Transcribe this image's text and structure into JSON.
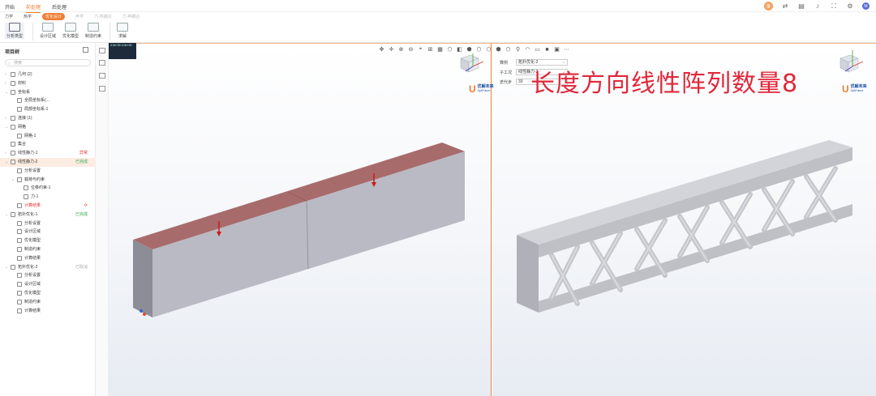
{
  "topbar": {
    "menus": [
      "开始",
      "前处理",
      "后处理"
    ],
    "active_menu": 1,
    "right_icons": [
      "share-icon",
      "document-icon",
      "bell-icon",
      "fullscreen-icon",
      "gear-icon"
    ],
    "badge": "备",
    "avatar": "M"
  },
  "ribbon_tabs": {
    "items": [
      "力学",
      "热学",
      "优化设计",
      "声学",
      "力-热耦合",
      "力-声耦合"
    ],
    "active": 2,
    "dim": [
      3,
      4,
      5
    ]
  },
  "ribbon": {
    "groups": [
      {
        "label": "分析类型"
      },
      {
        "label": "设计区域"
      },
      {
        "label": "优化模型"
      },
      {
        "label": "制造约束"
      },
      {
        "label": "求解"
      }
    ]
  },
  "sidebar": {
    "title": "项目树",
    "search_placeholder": "搜索",
    "tree": [
      {
        "label": "几何 (2)",
        "depth": 0,
        "arrow": "›"
      },
      {
        "label": "材料",
        "depth": 0,
        "arrow": "›"
      },
      {
        "label": "坐标系",
        "depth": 0,
        "arrow": "⌄"
      },
      {
        "label": "全局坐标系(...",
        "depth": 1,
        "arrow": ""
      },
      {
        "label": "局部坐标系-1",
        "depth": 1,
        "arrow": ""
      },
      {
        "label": "连接 (1)",
        "depth": 0,
        "arrow": "›"
      },
      {
        "label": "网格",
        "depth": 0,
        "arrow": "⌄"
      },
      {
        "label": "网格-1",
        "depth": 1,
        "arrow": ""
      },
      {
        "label": "集合",
        "depth": 0,
        "arrow": ""
      },
      {
        "label": "线性静力-1",
        "depth": 0,
        "arrow": "›",
        "status": "异常",
        "status_class": "red"
      },
      {
        "label": "线性静力-2",
        "depth": 0,
        "arrow": "⌄",
        "status": "已完成",
        "status_class": "green",
        "highlight": true
      },
      {
        "label": "分析设置",
        "depth": 1,
        "arrow": ""
      },
      {
        "label": "载荷与约束",
        "depth": 1,
        "arrow": "⌄"
      },
      {
        "label": "位移约束-1",
        "depth": 2,
        "arrow": ""
      },
      {
        "label": "力-1",
        "depth": 2,
        "arrow": ""
      },
      {
        "label": "计算结果",
        "depth": 1,
        "arrow": "",
        "status": "⟳",
        "status_class": "red",
        "text_class": "red"
      },
      {
        "label": "拓扑优化-1",
        "depth": 0,
        "arrow": "⌄",
        "status": "已完成",
        "status_class": "green"
      },
      {
        "label": "分析设置",
        "depth": 1,
        "arrow": ""
      },
      {
        "label": "设计区域",
        "depth": 1,
        "arrow": ""
      },
      {
        "label": "优化模型",
        "depth": 1,
        "arrow": ""
      },
      {
        "label": "制造约束",
        "depth": 1,
        "arrow": ""
      },
      {
        "label": "计算结果",
        "depth": 1,
        "arrow": ""
      },
      {
        "label": "拓扑优化-2",
        "depth": 0,
        "arrow": "⌄",
        "status": "已取消",
        "status_class": "gray"
      },
      {
        "label": "分析设置",
        "depth": 1,
        "arrow": ""
      },
      {
        "label": "设计区域",
        "depth": 1,
        "arrow": ""
      },
      {
        "label": "优化模型",
        "depth": 1,
        "arrow": ""
      },
      {
        "label": "制造约束",
        "depth": 1,
        "arrow": ""
      },
      {
        "label": "计算结果",
        "depth": 1,
        "arrow": ""
      }
    ]
  },
  "viewport_right": {
    "props": [
      {
        "label": "算例",
        "value": "拓扑优化-2"
      },
      {
        "label": "子工况",
        "value": "线性静力-2"
      },
      {
        "label": "迭代步",
        "value": "33"
      }
    ],
    "overlay_text": "长度方向线性阵列数量8"
  },
  "logo": {
    "cn": "优解未来",
    "en": "OptFuture"
  },
  "thumbnail": {
    "text": "3.0e+00 4.0e+00"
  },
  "colors": {
    "accent": "#f07d32",
    "beam_top": "#a86b6b",
    "beam_side": "#b8b9c2",
    "lattice": "#c8c9cf",
    "overlay": "#e0283a"
  }
}
